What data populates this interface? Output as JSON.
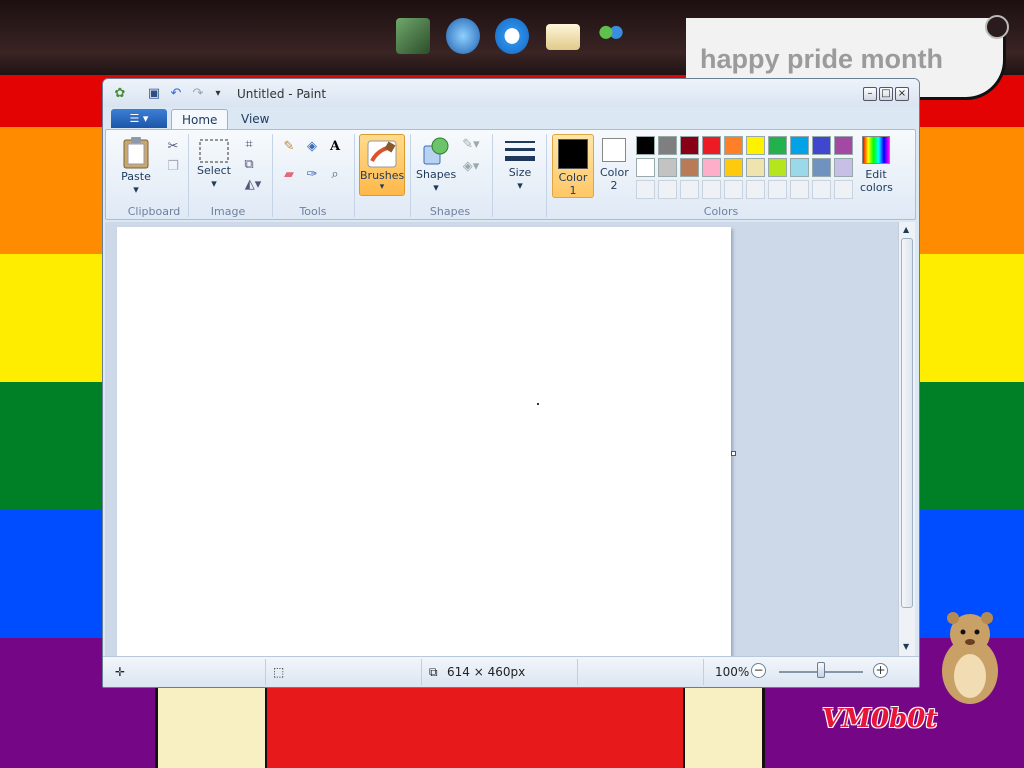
{
  "desktop": {
    "banner_text": "happy pride month",
    "brand_text": "VM0b0t",
    "stripe_colors": [
      "#e40303",
      "#ff8c00",
      "#ffed00",
      "#008026",
      "#004dff",
      "#750787"
    ],
    "dock_icons": [
      "media-center-icon",
      "ie-download-icon",
      "internet-explorer-icon",
      "mail-icon",
      "messenger-icon"
    ]
  },
  "window": {
    "title": "Untitled - Paint",
    "tabs": [
      "Home",
      "View"
    ],
    "active_tab": "Home"
  },
  "ribbon": {
    "groups": {
      "clipboard": "Clipboard",
      "image": "Image",
      "tools": "Tools",
      "shapes": "Shapes",
      "colors": "Colors"
    },
    "buttons": {
      "paste": "Paste",
      "select": "Select",
      "brushes": "Brushes",
      "shapes": "Shapes",
      "size": "Size",
      "color1": "Color 1",
      "color2": "Color 2",
      "edit_colors": "Edit colors"
    },
    "palette_row1": [
      "#000000",
      "#7f7f7f",
      "#880015",
      "#ed1c24",
      "#ff7f27",
      "#fff200",
      "#22b14c",
      "#00a2e8",
      "#3f48cc",
      "#a349a4"
    ],
    "palette_row2": [
      "#ffffff",
      "#c3c3c3",
      "#b97a57",
      "#ffaec9",
      "#ffc90e",
      "#efe4b0",
      "#b5e61d",
      "#99d9ea",
      "#7092be",
      "#c8bfe7"
    ],
    "color1": "#000000",
    "color2": "#ffffff"
  },
  "status": {
    "dimensions": "614 × 460px",
    "zoom": "100%"
  }
}
